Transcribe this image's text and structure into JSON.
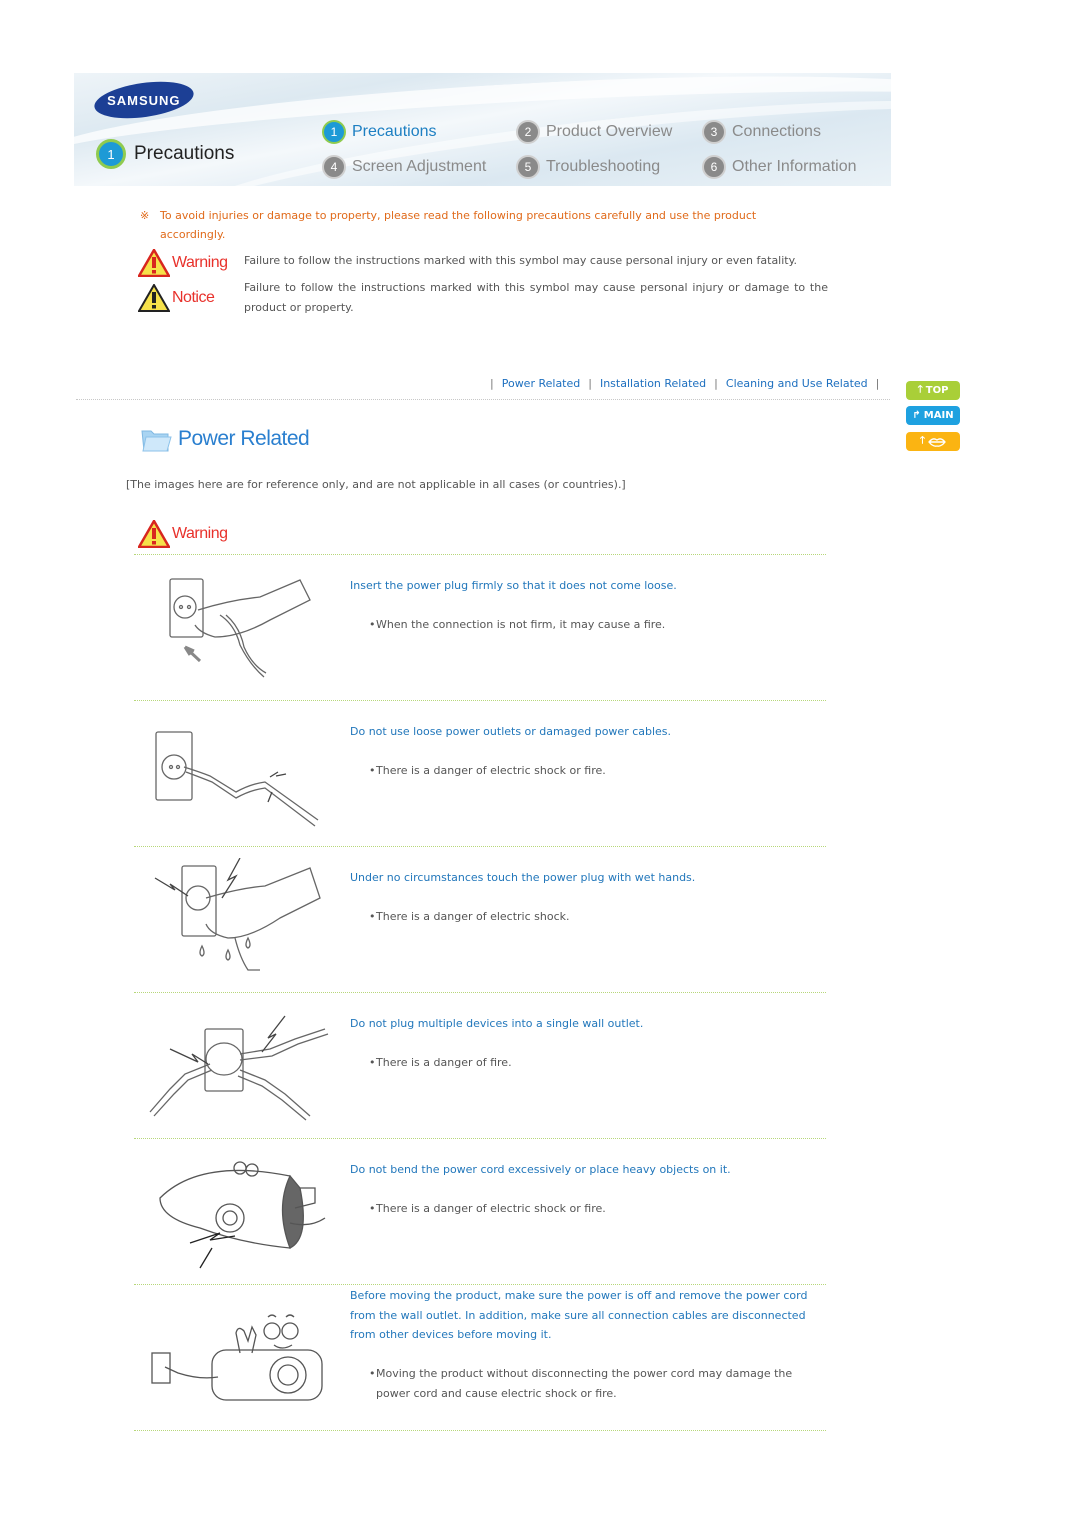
{
  "header": {
    "brand": "SAMSUNG",
    "section_number": "1",
    "section_title": "Precautions",
    "nav": [
      {
        "number": "1",
        "label": "Precautions",
        "active": true
      },
      {
        "number": "2",
        "label": "Product Overview",
        "active": false
      },
      {
        "number": "3",
        "label": "Connections",
        "active": false
      },
      {
        "number": "4",
        "label": "Screen Adjustment",
        "active": false
      },
      {
        "number": "5",
        "label": "Troubleshooting",
        "active": false
      },
      {
        "number": "6",
        "label": "Other Information",
        "active": false
      }
    ]
  },
  "intro": {
    "mark": "※",
    "line1": "To avoid injuries or damage to property, please read the following precautions carefully and use the product",
    "line2": "accordingly.",
    "symbols": [
      {
        "icon": "warning-triangle-red",
        "label": "Warning",
        "text": "Failure to follow the instructions marked with this symbol may cause personal injury or even fatality."
      },
      {
        "icon": "warning-triangle-yellow",
        "label": "Notice",
        "text": "Failure to follow the instructions marked with this symbol may cause personal injury or damage to the product or property."
      }
    ]
  },
  "section_tabs": {
    "separator": "|",
    "items": [
      "Power Related",
      "Installation Related",
      "Cleaning and Use Related"
    ]
  },
  "side_buttons": [
    {
      "label": "TOP",
      "icon": "arrow-up-icon",
      "color": "#a9cf38"
    },
    {
      "label": "MAIN",
      "icon": "turn-up-arrow-icon",
      "color": "#1ea1e0"
    },
    {
      "label": "",
      "icon": "arrow-up-lips-icon",
      "color": "#fbb412"
    }
  ],
  "section": {
    "title": "Power Related",
    "note": "[The images here are for reference only, and are not applicable in all cases (or countries).]",
    "warning_label": "Warning",
    "items": [
      {
        "illustration": "hand-inserting-plug",
        "title": "Insert the power plug firmly so that it does not come loose.",
        "bullet": "When the connection is not firm, it may cause a fire."
      },
      {
        "illustration": "damaged-cable-outlet",
        "title": "Do not use loose power outlets or damaged power cables.",
        "bullet": "There is a danger of electric shock or fire."
      },
      {
        "illustration": "wet-hand-plug",
        "title": "Under no circumstances touch the power plug with wet hands.",
        "bullet": "There is a danger of electric shock."
      },
      {
        "illustration": "overloaded-outlet",
        "title": "Do not plug multiple devices into a single wall outlet.",
        "bullet": "There is a danger of fire."
      },
      {
        "illustration": "bent-cord-projector",
        "title": "Do not bend the power cord excessively or place heavy objects on it.",
        "bullet": "There is a danger of electric shock or fire."
      },
      {
        "illustration": "moving-projector",
        "title": "Before moving the product, make sure the power is off and remove the power cord from the wall outlet. In addition, make sure all connection cables are disconnected from other devices before moving it.",
        "bullet": "Moving the product without disconnecting the power cord may damage the power cord and cause electric shock or fire."
      }
    ]
  },
  "colors": {
    "link_blue": "#2277bb",
    "intro_orange": "#e06a1a",
    "warning_red": "#e8312b",
    "body_gray": "#555555"
  }
}
